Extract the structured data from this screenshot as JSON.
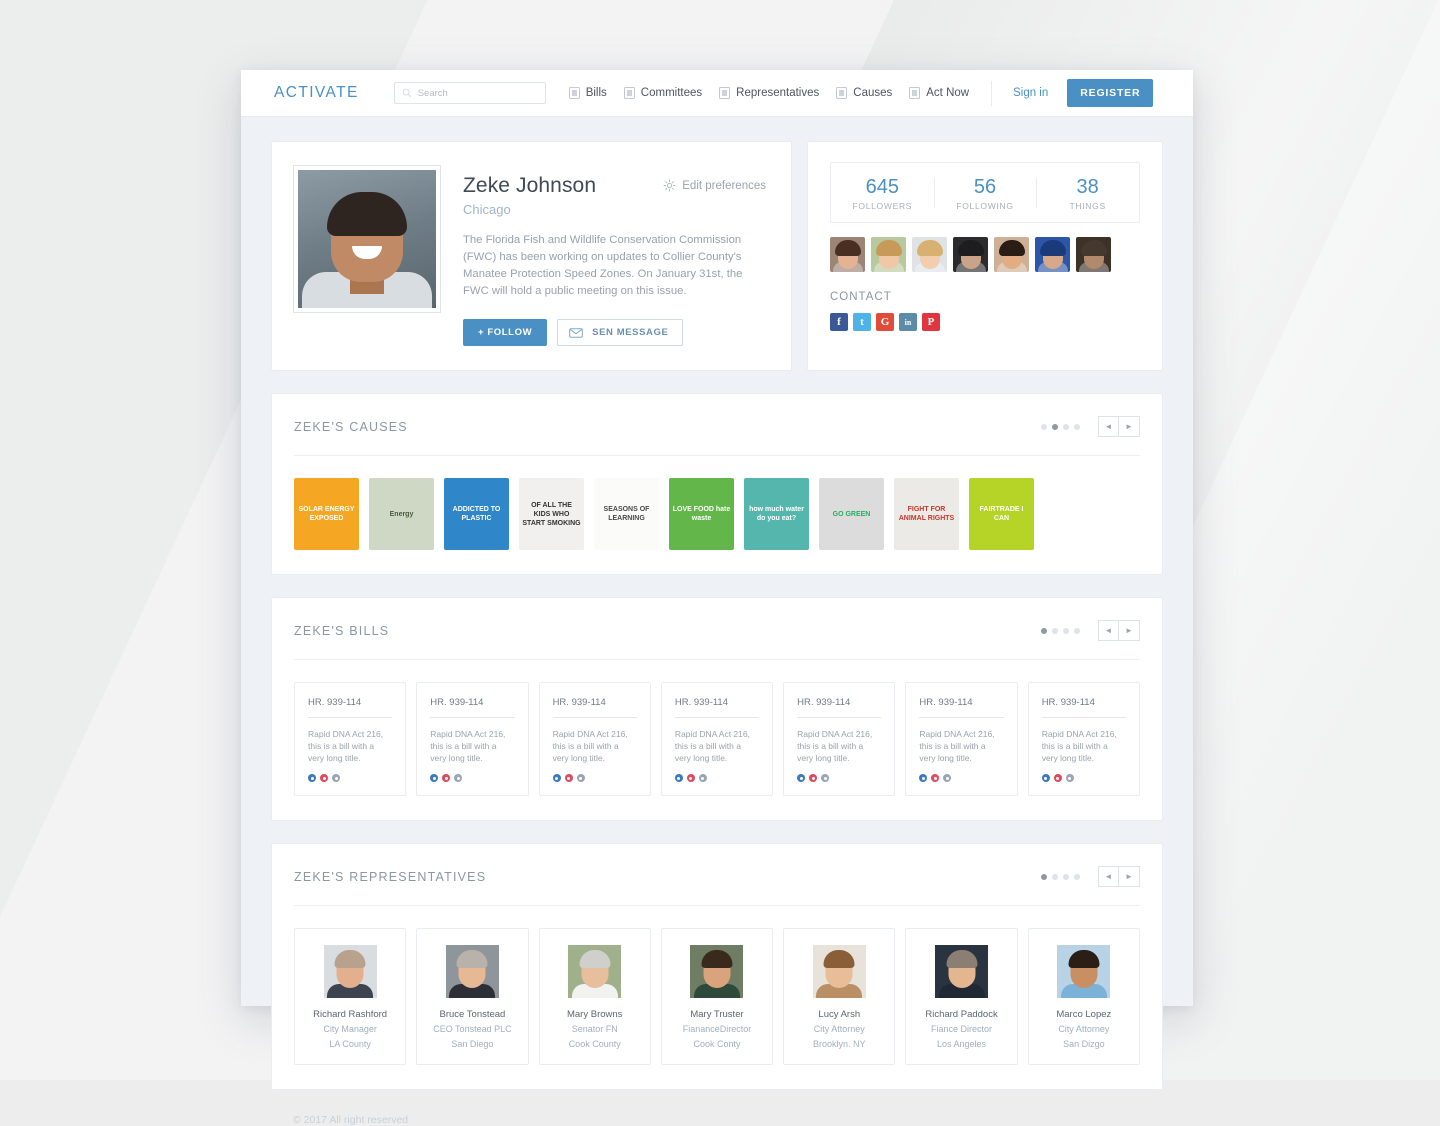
{
  "header": {
    "brand": "ACTIVATE",
    "search": {
      "placeholder": "Search",
      "value": "",
      "icon": "search-icon"
    },
    "nav": [
      {
        "label": "Bills",
        "icon": "bills-icon"
      },
      {
        "label": "Committees",
        "icon": "committees-icon"
      },
      {
        "label": "Representatives",
        "icon": "representatives-icon"
      },
      {
        "label": "Causes",
        "icon": "causes-icon"
      },
      {
        "label": "Act Now",
        "icon": "act-now-icon"
      }
    ],
    "sign_in": "Sign in",
    "register": "REGISTER",
    "accent_color": "#4a90c4"
  },
  "profile": {
    "name": "Zeke Johnson",
    "city": "Chicago",
    "bio": "The Florida Fish and Wildlife Conservation Commission (FWC) has been working on updates to Collier County's Manatee Protection Speed Zones. On January 31st, the FWC will hold a public meeting on this issue.",
    "edit_preferences": "Edit preferences",
    "follow_button": "+ FOLLOW",
    "message_button": "SEN MESSAGE"
  },
  "stats": {
    "items": [
      {
        "value": "645",
        "label": "FOLLOWERS"
      },
      {
        "value": "56",
        "label": "FOLLOWING"
      },
      {
        "value": "38",
        "label": "THINGS"
      }
    ],
    "avatars": [
      {
        "skin": "#e3b394",
        "hair": "#4b2e22",
        "bg": "#9c8577"
      },
      {
        "skin": "#f0c8a8",
        "hair": "#c79a5a",
        "bg": "#b9c99f"
      },
      {
        "skin": "#f2cdae",
        "hair": "#d8b070",
        "bg": "#dfe3e6"
      },
      {
        "skin": "#c9a488",
        "hair": "#1d1d1f",
        "bg": "#2b2b2d"
      },
      {
        "skin": "#e0ae82",
        "hair": "#2a1d16",
        "bg": "#cdb095"
      },
      {
        "skin": "#d7a98a",
        "hair": "#1b3a7a",
        "bg": "#2e56a8"
      },
      {
        "skin": "#b08a6a",
        "hair": "#45382e",
        "bg": "#3c3228"
      }
    ],
    "contact_label": "CONTACT",
    "social": [
      {
        "name": "facebook",
        "glyph": "f",
        "color": "#3b5998"
      },
      {
        "name": "twitter",
        "glyph": "t",
        "color": "#4fb3e8"
      },
      {
        "name": "google-plus",
        "glyph": "G",
        "color": "#e04b3a"
      },
      {
        "name": "linkedin",
        "glyph": "in",
        "color": "#5d8ca8"
      },
      {
        "name": "pinterest",
        "glyph": "P",
        "color": "#e0353f"
      }
    ]
  },
  "causes_section": {
    "title": "ZEKE'S CAUSES",
    "dots": [
      false,
      true,
      false,
      false
    ],
    "prev": "◄",
    "next": "►",
    "items": [
      {
        "title": "SOLAR ENERGY EXPOSED",
        "bg": "#f5a623",
        "fg": "#ffffff"
      },
      {
        "title": "Energy",
        "bg": "#cfd8c4",
        "fg": "#4a5b3c"
      },
      {
        "title": "ADDICTED TO PLASTIC",
        "bg": "#2f86c8",
        "fg": "#ffffff"
      },
      {
        "title": "OF ALL THE KIDS WHO START SMOKING",
        "bg": "#f2f0ee",
        "fg": "#333333"
      },
      {
        "title": "SEASONS OF LEARNING",
        "bg": "#fbfbfa",
        "fg": "#4a4a4a"
      },
      {
        "title": "LOVE FOOD hate waste",
        "bg": "#62b64a",
        "fg": "#ffffff"
      },
      {
        "title": "how much water do you eat?",
        "bg": "#55b6ae",
        "fg": "#ffffff"
      },
      {
        "title": "GO GREEN",
        "bg": "#dcdcdc",
        "fg": "#27ae60"
      },
      {
        "title": "FIGHT FOR ANIMAL RIGHTS",
        "bg": "#eceae6",
        "fg": "#c0392b"
      },
      {
        "title": "FAIRTRADE I CAN",
        "bg": "#b6d427",
        "fg": "#ffffff"
      }
    ]
  },
  "bills_section": {
    "title": "ZEKE'S BILLS",
    "dots": [
      true,
      false,
      false,
      false
    ],
    "prev": "◄",
    "next": "►",
    "items": [
      {
        "id": "HR. 939-114",
        "desc": "Rapid DNA Act 216, this is a bill with a very long title."
      },
      {
        "id": "HR. 939-114",
        "desc": "Rapid DNA Act 216, this is a bill with a very long title."
      },
      {
        "id": "HR. 939-114",
        "desc": "Rapid DNA Act 216, this is a bill with a very long title."
      },
      {
        "id": "HR. 939-114",
        "desc": "Rapid DNA Act 216, this is a bill with a very long title."
      },
      {
        "id": "HR. 939-114",
        "desc": "Rapid DNA Act 216, this is a bill with a very long title."
      },
      {
        "id": "HR. 939-114",
        "desc": "Rapid DNA Act 216, this is a bill with a very long title."
      },
      {
        "id": "HR. 939-114",
        "desc": "Rapid DNA Act 216, this is a bill with a very long title."
      }
    ],
    "dot_colors": [
      "#3b78c2",
      "#e0495c",
      "#9aa5b1"
    ]
  },
  "reps_section": {
    "title": "ZEKE'S REPRESENTATIVES",
    "dots": [
      true,
      false,
      false,
      false
    ],
    "prev": "◄",
    "next": "►",
    "items": [
      {
        "name": "Richard Rashford",
        "title": "City Manager",
        "location": "LA County",
        "skin": "#e2b08c",
        "hair": "#b8a28e",
        "body": "#3d4450",
        "bg": "#d9dde0"
      },
      {
        "name": "Bruce Tonstead",
        "title": "CEO Tonstead PLC",
        "location": "San Diego",
        "skin": "#e6b893",
        "hair": "#b9b2aa",
        "body": "#2c2f36",
        "bg": "#8e959b"
      },
      {
        "name": "Mary Browns",
        "title": "Senator FN",
        "location": "Cook County",
        "skin": "#e8bf9c",
        "hair": "#cfcfcb",
        "body": "#f2f2f0",
        "bg": "#9fb08a"
      },
      {
        "name": "Mary Truster",
        "title": "FiananceDirector",
        "location": "Cook Conty",
        "skin": "#d9a37c",
        "hair": "#3a2a1e",
        "body": "#2f4a3a",
        "bg": "#6e7d64"
      },
      {
        "name": "Lucy Arsh",
        "title": "City Attorney",
        "location": "Brooklyn. NY",
        "skin": "#e9bd97",
        "hair": "#8a5f37",
        "body": "#b98f63",
        "bg": "#e7e2da"
      },
      {
        "name": "Richard Paddock",
        "title": "Fiance Director",
        "location": "Los Angeles",
        "skin": "#e4b68f",
        "hair": "#8b7f74",
        "body": "#1f2833",
        "bg": "#2a3340"
      },
      {
        "name": "Marco Lopez",
        "title": "City Attorney",
        "location": "San Dizgo",
        "skin": "#c98f63",
        "hair": "#2b1e17",
        "body": "#7cb2d8",
        "bg": "#b9d3e6"
      }
    ]
  },
  "footer": {
    "text": "© 2017 All right reserved"
  }
}
